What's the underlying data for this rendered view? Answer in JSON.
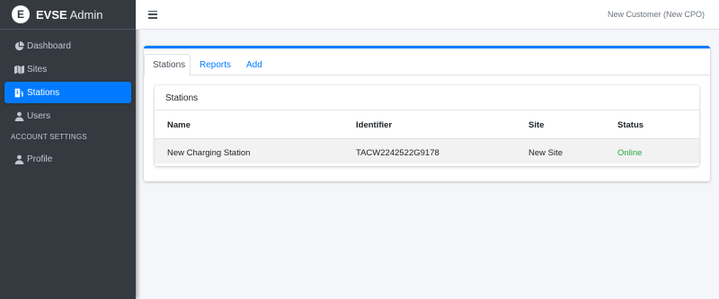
{
  "app": {
    "logo_letter": "E",
    "brand_bold": "EVSE",
    "brand_light": "Admin"
  },
  "sidebar": {
    "items": [
      {
        "label": "Dashboard",
        "icon": "pie-chart-icon"
      },
      {
        "label": "Sites",
        "icon": "map-icon"
      },
      {
        "label": "Stations",
        "icon": "charging-station-icon",
        "active": true
      },
      {
        "label": "Users",
        "icon": "user-icon"
      }
    ],
    "section_header": "ACCOUNT SETTINGS",
    "settings_items": [
      {
        "label": "Profile",
        "icon": "user-icon"
      }
    ]
  },
  "topbar": {
    "menu_icon": "hamburger-icon",
    "user_label": "New Customer (New CPO)"
  },
  "main": {
    "tabs": [
      {
        "label": "Stations",
        "active": true
      },
      {
        "label": "Reports"
      },
      {
        "label": "Add"
      }
    ],
    "stations_card": {
      "title": "Stations",
      "columns": [
        "Name",
        "Identifier",
        "Site",
        "Status"
      ],
      "rows": [
        {
          "name": "New Charging Station",
          "identifier": "TACW2242522G9178",
          "site": "New Site",
          "status": "Online"
        }
      ]
    }
  },
  "colors": {
    "accent": "#007bff",
    "sidebar_bg": "#343a40",
    "status_online": "#28a745"
  }
}
